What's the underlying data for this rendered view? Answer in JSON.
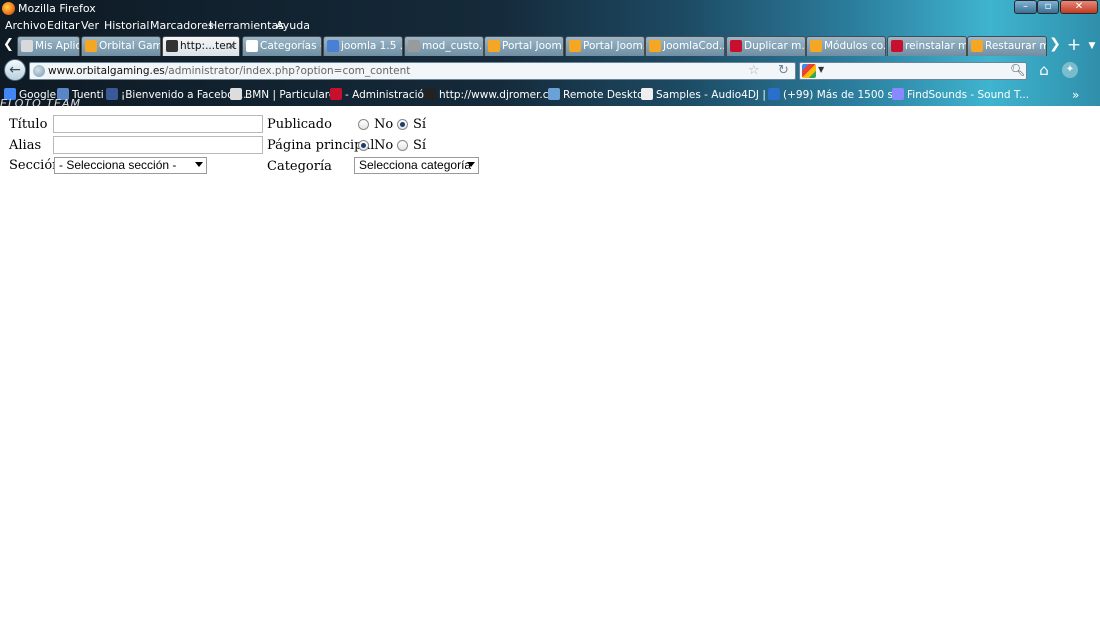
{
  "window": {
    "title": "Mozilla Firefox",
    "minimize": "–",
    "maximize": "▫",
    "close": "✕"
  },
  "menu": [
    "Archivo",
    "Editar",
    "Ver",
    "Historial",
    "Marcadores",
    "Herramientas",
    "Ayuda"
  ],
  "tabs": [
    {
      "label": "Mis Aplicaci...",
      "icon_color": "#d9d9d9"
    },
    {
      "label": "Orbital Gam...",
      "icon_color": "#f5a623"
    },
    {
      "label": "http:...tent",
      "icon_color": "#333333",
      "active": true
    },
    {
      "label": "Categorías -...",
      "icon_color": "#ffffff"
    },
    {
      "label": "joomla 1.5 ...",
      "icon_color": "#4a7fd6"
    },
    {
      "label": "mod_custo...",
      "icon_color": "#9a9a9a"
    },
    {
      "label": "Portal Joom...",
      "icon_color": "#f5a623"
    },
    {
      "label": "Portal Joom...",
      "icon_color": "#f5a623"
    },
    {
      "label": "JoomlaCod...",
      "icon_color": "#f5a623"
    },
    {
      "label": "Duplicar m...",
      "icon_color": "#c8102e"
    },
    {
      "label": "Módulos co...",
      "icon_color": "#f5a623"
    },
    {
      "label": "reinstalar m...",
      "icon_color": "#c8102e"
    },
    {
      "label": "Restaurar m...",
      "icon_color": "#f5a623"
    }
  ],
  "tab_close": "×",
  "nav": {
    "url_domain": "www.orbitalgaming.es",
    "url_path": "/administrator/index.php?option=com_content"
  },
  "bookmarks": [
    {
      "label": "Google",
      "icon_color": "#4285f4"
    },
    {
      "label": "Tuenti",
      "icon_color": "#5b86c5"
    },
    {
      "label": "¡Bienvenido a Faceboo...",
      "icon_color": "#3b5998"
    },
    {
      "label": "BMN | Particulares",
      "icon_color": "#dddddd"
    },
    {
      "label": "- Administración",
      "icon_color": "#c8102e"
    },
    {
      "label": "http://www.djromer.c...",
      "icon_color": "#222222"
    },
    {
      "label": "Remote Desktop",
      "icon_color": "#6aa2d8"
    },
    {
      "label": "Samples - Audio4DJ | ...",
      "icon_color": "#eeeeee"
    },
    {
      "label": "(+99) Más de 1500 s...",
      "icon_color": "#2a6fc9"
    },
    {
      "label": "FindSounds - Sound T...",
      "icon_color": "#8888ff"
    }
  ],
  "wallpaper_text": "ELOTO TEAM",
  "form": {
    "titulo_label": "Título",
    "titulo_value": "",
    "alias_label": "Alias",
    "alias_value": "",
    "seccion_label": "Sección",
    "seccion_value": "- Selecciona sección -",
    "publicado_label": "Publicado",
    "publicado_options": [
      "No",
      "Sí"
    ],
    "publicado_selected": "Sí",
    "pagina_label": "Página principal",
    "pagina_options": [
      "No",
      "Sí"
    ],
    "pagina_selected": "No",
    "categoria_label": "Categoría",
    "categoria_value": "Selecciona categoría"
  }
}
